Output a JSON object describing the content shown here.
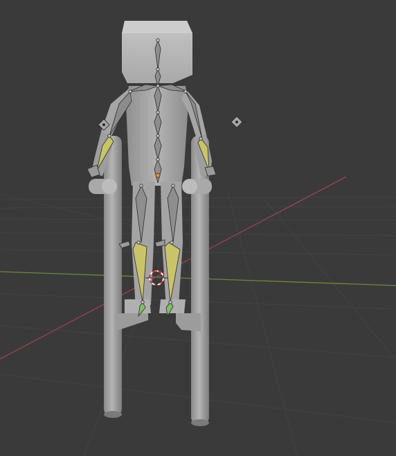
{
  "viewport": {
    "background": "#3a3a3a",
    "grid_color": "#454545",
    "x_axis_color": "#a0444f",
    "y_axis_color": "#6b8f3a",
    "mesh_color": "#9a9a9a",
    "bone_color": "#8c8c8c",
    "selected_bone_color": "#c9c36a",
    "pose_bone_color": "#7fbf6a",
    "cursor_colors": [
      "#e03030",
      "#ffffff"
    ],
    "origin_color": "#ff8a2a"
  },
  "objects": {
    "character": "character-mesh",
    "armature": "armature",
    "stilts": "stilt-props",
    "light": "light-object",
    "cursor": "3d-cursor"
  }
}
